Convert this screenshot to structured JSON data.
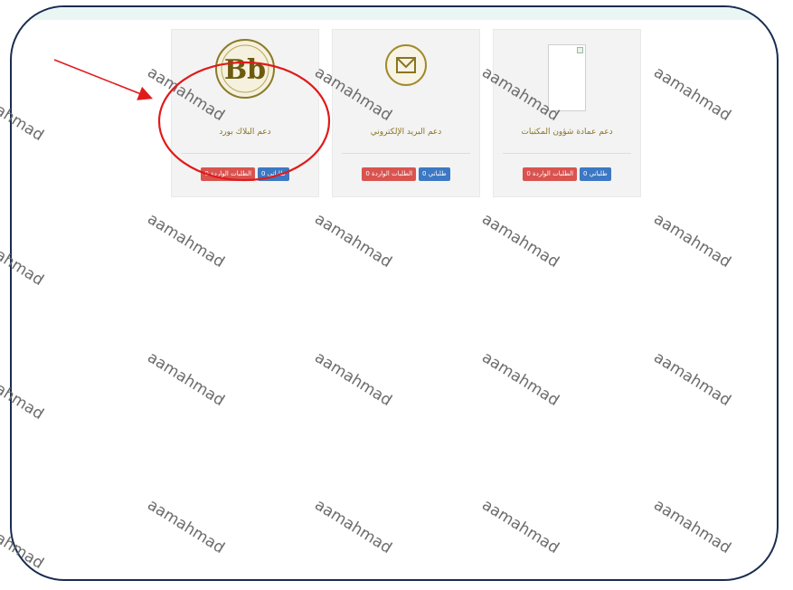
{
  "cards": [
    {
      "title": "دعم عمادة شؤون المكتبات",
      "icon": "broken-image-icon",
      "requests_label": "طلباتي 0",
      "incoming_label": "الطلبات الواردة 0"
    },
    {
      "title": "دعم البريد الإلكتروني",
      "icon": "envelope-icon",
      "requests_label": "طلباتي 0",
      "incoming_label": "الطلبات الواردة 0"
    },
    {
      "title": "دعم البلاك بورد",
      "icon": "blackboard-logo-icon",
      "logo_text": "Bb",
      "requests_label": "طلباتي 0",
      "incoming_label": "الطلبات الواردة 0"
    }
  ],
  "watermark": {
    "text": "aamahmad"
  },
  "colors": {
    "frame_border": "#1a2d4f",
    "button_blue": "#3c78c3",
    "button_red": "#d9534f",
    "title_gold": "#8a7420",
    "annotation_red": "#e01b1b"
  }
}
